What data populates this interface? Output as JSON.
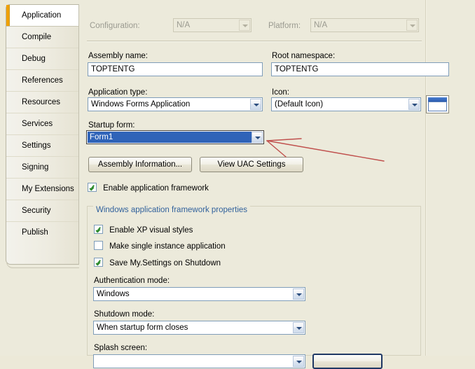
{
  "sidebar": {
    "items": [
      {
        "label": "Application",
        "selected": true
      },
      {
        "label": "Compile",
        "selected": false
      },
      {
        "label": "Debug",
        "selected": false
      },
      {
        "label": "References",
        "selected": false
      },
      {
        "label": "Resources",
        "selected": false
      },
      {
        "label": "Services",
        "selected": false
      },
      {
        "label": "Settings",
        "selected": false
      },
      {
        "label": "Signing",
        "selected": false
      },
      {
        "label": "My Extensions",
        "selected": false
      },
      {
        "label": "Security",
        "selected": false
      },
      {
        "label": "Publish",
        "selected": false
      }
    ]
  },
  "toolbar": {
    "configuration_label": "Configuration:",
    "configuration_value": "N/A",
    "platform_label": "Platform:",
    "platform_value": "N/A"
  },
  "application": {
    "assembly_name_label": "Assembly name:",
    "assembly_name_value": "TOPTENTG",
    "root_namespace_label": "Root namespace:",
    "root_namespace_value": "TOPTENTG",
    "application_type_label": "Application type:",
    "application_type_value": "Windows Forms Application",
    "icon_label": "Icon:",
    "icon_value": "(Default Icon)",
    "icon_preview_name": "window-icon",
    "startup_form_label": "Startup form:",
    "startup_form_value": "Form1",
    "assembly_information_button": "Assembly Information...",
    "view_uac_button": "View UAC Settings",
    "enable_framework_label": "Enable application framework",
    "enable_framework_checked": true
  },
  "framework_group": {
    "title": "Windows application framework properties",
    "checkboxes": [
      {
        "label": "Enable XP visual styles",
        "checked": true
      },
      {
        "label": "Make single instance application",
        "checked": false
      },
      {
        "label": "Save My.Settings on Shutdown",
        "checked": true
      }
    ],
    "authentication_mode_label": "Authentication mode:",
    "authentication_mode_value": "Windows",
    "shutdown_mode_label": "Shutdown mode:",
    "shutdown_mode_value": "When startup form closes",
    "splash_screen_label": "Splash screen:"
  },
  "annotation": {
    "color": "#c0504d",
    "target": "startup-form-combo-dropdown-arrow"
  }
}
